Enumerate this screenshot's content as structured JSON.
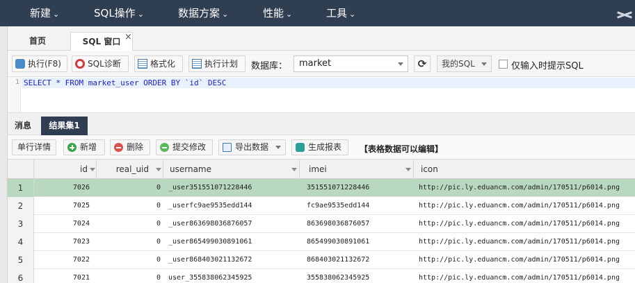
{
  "nav": {
    "items": [
      "新建",
      "SQL操作",
      "数据方案",
      "性能",
      "工具"
    ]
  },
  "tabs": {
    "home": "首页",
    "sql_window": "SQL 窗口",
    "close": "×"
  },
  "toolbar": {
    "run": "执行(F8)",
    "diagnose": "SQL诊断",
    "format": "格式化",
    "plan": "执行计划",
    "db_label": "数据库：",
    "db_value": "market",
    "refresh": "⟳",
    "my_sql": "我的SQL",
    "hint_label": "仅输入时提示SQL"
  },
  "editor": {
    "line_number": "1",
    "sql": "SELECT * FROM market_user ORDER BY `id` DESC"
  },
  "result_tabs": {
    "messages": "消息",
    "result_set": "结果集1"
  },
  "result_toolbar": {
    "row_detail": "单行详情",
    "add": "新增",
    "delete": "删除",
    "submit": "提交修改",
    "export": "导出数据",
    "report": "生成报表",
    "editable_note": "【表格数据可以编辑】"
  },
  "grid": {
    "columns": [
      "id",
      "real_uid",
      "username",
      "imei",
      "icon"
    ],
    "rows": [
      [
        "1",
        "7026",
        "0",
        "_user351551071228446",
        "351551071228446",
        "http://pic.ly.eduancm.com/admin/170511/p6014.png"
      ],
      [
        "2",
        "7025",
        "0",
        "_userfc9ae9535edd144",
        "fc9ae9535edd144",
        "http://pic.ly.eduancm.com/admin/170511/p6014.png"
      ],
      [
        "3",
        "7024",
        "0",
        "_user863698036876057",
        "863698036876057",
        "http://pic.ly.eduancm.com/admin/170511/p6014.png"
      ],
      [
        "4",
        "7023",
        "0",
        "_user865499030891061",
        "865499030891061",
        "http://pic.ly.eduancm.com/admin/170511/p6014.png"
      ],
      [
        "5",
        "7022",
        "0",
        "_user868403021132672",
        "868403021132672",
        "http://pic.ly.eduancm.com/admin/170511/p6014.png"
      ],
      [
        "6",
        "7021",
        "0",
        "user_355838062345925",
        "355838062345925",
        "http://pic.ly.eduancm.com/admin/170511/p6014.png"
      ]
    ]
  },
  "colors": {
    "nav_bg": "#2f3e50",
    "selected_row": "#b9d8c0",
    "active_tab": "#2f3e50"
  }
}
